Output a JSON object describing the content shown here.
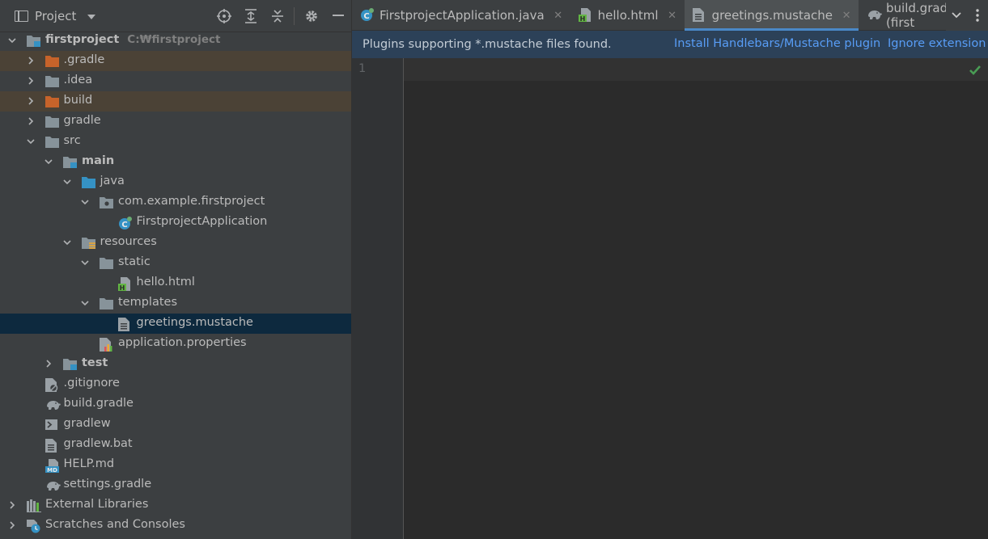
{
  "project_panel": {
    "title": "Project",
    "root_path": "C:₩firstproject",
    "tree": [
      {
        "label": "firstproject",
        "bold": true,
        "level": 0,
        "arrow": "down",
        "icon": "module-folder",
        "name": "tree-item-firstproject"
      },
      {
        "label": ".gradle",
        "level": 1,
        "arrow": "right",
        "icon": "folder-excluded",
        "excluded": true,
        "name": "tree-item-dot-gradle"
      },
      {
        "label": ".idea",
        "level": 1,
        "arrow": "right",
        "icon": "folder",
        "name": "tree-item-idea"
      },
      {
        "label": "build",
        "level": 1,
        "arrow": "right",
        "icon": "folder-excluded",
        "excluded": true,
        "name": "tree-item-build"
      },
      {
        "label": "gradle",
        "level": 1,
        "arrow": "right",
        "icon": "folder",
        "name": "tree-item-gradle"
      },
      {
        "label": "src",
        "level": 1,
        "arrow": "down",
        "icon": "folder",
        "name": "tree-item-src"
      },
      {
        "label": "main",
        "bold": true,
        "level": 2,
        "arrow": "down",
        "icon": "module-folder",
        "name": "tree-item-main"
      },
      {
        "label": "java",
        "level": 3,
        "arrow": "down",
        "icon": "source-folder",
        "name": "tree-item-java"
      },
      {
        "label": "com.example.firstproject",
        "level": 4,
        "arrow": "down",
        "icon": "package",
        "name": "tree-item-package"
      },
      {
        "label": "FirstprojectApplication",
        "level": 5,
        "arrow": "none",
        "icon": "spring-class",
        "name": "tree-item-firstproject-application"
      },
      {
        "label": "resources",
        "level": 3,
        "arrow": "down",
        "icon": "resources-folder",
        "name": "tree-item-resources"
      },
      {
        "label": "static",
        "level": 4,
        "arrow": "down",
        "icon": "folder",
        "name": "tree-item-static"
      },
      {
        "label": "hello.html",
        "level": 5,
        "arrow": "none",
        "icon": "html-file",
        "name": "tree-item-hello-html"
      },
      {
        "label": "templates",
        "level": 4,
        "arrow": "down",
        "icon": "folder",
        "name": "tree-item-templates"
      },
      {
        "label": "greetings.mustache",
        "level": 5,
        "arrow": "none",
        "icon": "text-file",
        "selected": true,
        "name": "tree-item-greetings-mustache"
      },
      {
        "label": "application.properties",
        "level": 4,
        "arrow": "none",
        "icon": "properties-file",
        "name": "tree-item-application-properties"
      },
      {
        "label": "test",
        "bold": true,
        "level": 2,
        "arrow": "right",
        "icon": "module-folder",
        "name": "tree-item-test"
      },
      {
        "label": ".gitignore",
        "level": 1,
        "arrow": "none",
        "icon": "ignore-file",
        "name": "tree-item-gitignore"
      },
      {
        "label": "build.gradle",
        "level": 1,
        "arrow": "none",
        "icon": "gradle-file",
        "name": "tree-item-build-gradle"
      },
      {
        "label": "gradlew",
        "level": 1,
        "arrow": "none",
        "icon": "shell-file",
        "name": "tree-item-gradlew"
      },
      {
        "label": "gradlew.bat",
        "level": 1,
        "arrow": "none",
        "icon": "text-file",
        "name": "tree-item-gradlew-bat"
      },
      {
        "label": "HELP.md",
        "level": 1,
        "arrow": "none",
        "icon": "markdown-file",
        "name": "tree-item-help-md"
      },
      {
        "label": "settings.gradle",
        "level": 1,
        "arrow": "none",
        "icon": "gradle-file",
        "name": "tree-item-settings-gradle"
      },
      {
        "label": "External Libraries",
        "level": 0,
        "arrow": "right",
        "icon": "libraries",
        "name": "tree-item-external-libraries"
      },
      {
        "label": "Scratches and Consoles",
        "level": 0,
        "arrow": "right",
        "icon": "scratches",
        "name": "tree-item-scratches"
      }
    ]
  },
  "editor": {
    "tabs": [
      {
        "label": "FirstprojectApplication.java",
        "icon": "spring-class",
        "close": "✕",
        "active": false,
        "name": "tab-firstproject-application"
      },
      {
        "label": "hello.html",
        "icon": "html-file",
        "close": "✕",
        "active": false,
        "name": "tab-hello-html"
      },
      {
        "label": "greetings.mustache",
        "icon": "text-file",
        "close": "✕",
        "active": true,
        "name": "tab-greetings-mustache"
      },
      {
        "label": "build.gradle (first",
        "icon": "gradle-file",
        "close": "",
        "active": false,
        "name": "tab-build-gradle"
      }
    ],
    "notification": {
      "message": "Plugins supporting *.mustache files found.",
      "install_link": "Install Handlebars/Mustache plugin",
      "ignore_link": "Ignore extension"
    },
    "line_numbers": [
      "1"
    ]
  },
  "colors": {
    "accent": "#4a88c7",
    "link": "#589df6",
    "excluded_row": "#4b4236",
    "selected_row": "#0d293e",
    "inspection_ok": "#499c54"
  }
}
